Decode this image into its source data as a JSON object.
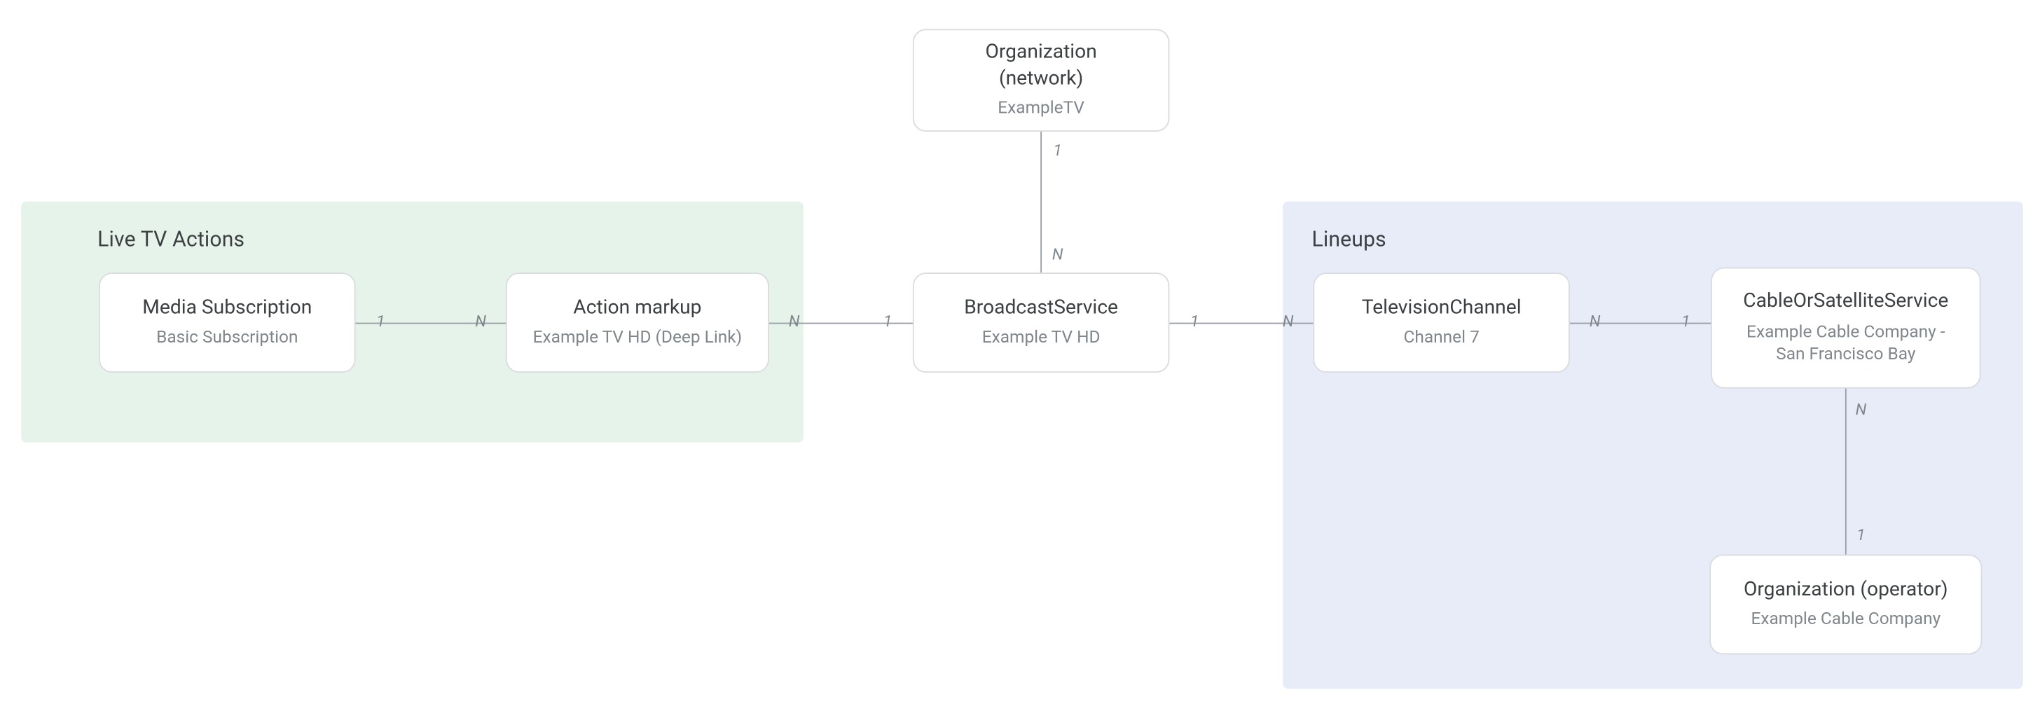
{
  "regions": {
    "liveTV": {
      "title": "Live TV Actions"
    },
    "lineups": {
      "title": "Lineups"
    }
  },
  "entities": {
    "orgNetwork": {
      "title": "Organization\n(network)",
      "subtitle": "ExampleTV"
    },
    "mediaSub": {
      "title": "Media Subscription",
      "subtitle": "Basic Subscription"
    },
    "actionMarkup": {
      "title": "Action markup",
      "subtitle": "Example TV HD (Deep Link)"
    },
    "broadcast": {
      "title": "BroadcastService",
      "subtitle": "Example TV HD"
    },
    "tvChannel": {
      "title": "TelevisionChannel",
      "subtitle": "Channel 7"
    },
    "cableSat": {
      "title": "CableOrSatelliteService",
      "subtitle": "Example Cable Company -\nSan Francisco Bay"
    },
    "orgOperator": {
      "title": "Organization (operator)",
      "subtitle": "Example Cable Company"
    }
  },
  "cardinalities": {
    "one": "1",
    "many": "N"
  }
}
